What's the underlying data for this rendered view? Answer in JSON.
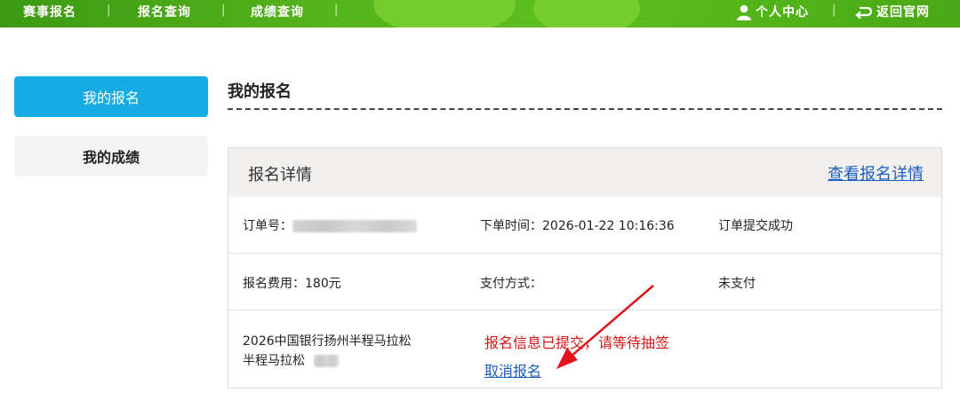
{
  "topnav": {
    "items": [
      "赛事报名",
      "报名查询",
      "成绩查询"
    ],
    "user_center": "个人中心",
    "back_official": "返回官网"
  },
  "sidebar": {
    "items": [
      {
        "label": "我的报名",
        "active": true
      },
      {
        "label": "我的成绩",
        "active": false
      }
    ]
  },
  "main": {
    "title": "我的报名"
  },
  "card": {
    "title": "报名详情",
    "view_details_link": "查看报名详情",
    "order_label": "订单号：",
    "order_time": "下单时间：2026-01-22 10:16:36",
    "order_status": "订单提交成功",
    "fee": "报名费用：180元",
    "payment_method": "支付方式：",
    "payment_status": "未支付",
    "event_name_line1": "2026中国银行扬州半程马拉松",
    "event_name_line2": "半程马拉松",
    "submit_message": "报名信息已提交，请等待抽签",
    "cancel_link": "取消报名"
  },
  "colors": {
    "topbar_green": "#56b41c",
    "sidebar_active": "#17abe6",
    "link_blue": "#1c5fbf",
    "alert_red": "#d41515"
  },
  "icons": [
    "person-icon",
    "return-arrow-icon",
    "pointer-arrow"
  ]
}
